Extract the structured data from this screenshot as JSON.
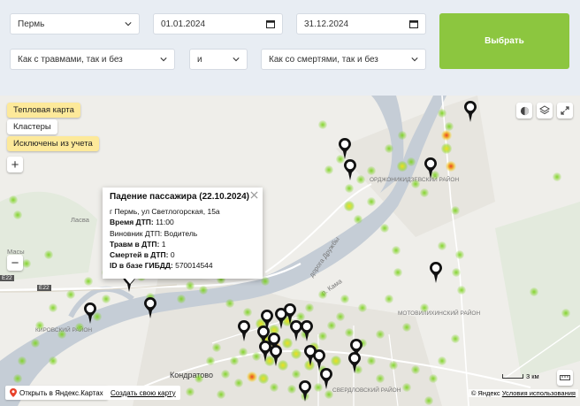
{
  "filters": {
    "city": "Пермь",
    "date_from": "01.01.2024",
    "date_to": "31.12.2024",
    "injuries": "Как с травмами, так и без",
    "logic": "и",
    "deaths": "Как со смертями, так и без",
    "submit_label": "Выбрать"
  },
  "map": {
    "layers": {
      "heatmap": "Тепловая карта",
      "clusters": "Клaстеры",
      "excluded": "Исключены из учета"
    },
    "zoom_in": "+",
    "zoom_out": "−",
    "popup": {
      "title": "Падение пассажира (22.10.2024)",
      "address": "г Пермь, ул Светлогорская, 15а",
      "time_label": "Время ДТП:",
      "time_value": "11:00",
      "culprit_label": "Виновник ДТП:",
      "culprit_value": "Водитель",
      "injured_label": "Травм в ДТП:",
      "injured_value": "1",
      "deaths_label": "Смертей в ДТП:",
      "deaths_value": "0",
      "id_label": "ID в базе ГИБДД:",
      "id_value": "570014544"
    },
    "labels": {
      "kondratovo": "Кондратово",
      "lasva": "Ласва",
      "masy": "Масы",
      "kirovsky": "КИРОВСКИЙ РАЙОН",
      "ordzhon": "ОРДЖОНИКИДЗЕВСКИЙ РАЙОН",
      "motovil": "МОТОВИЛИХИНСКИЙ РАЙОН",
      "sverdl": "СВЕРДЛОВСКИЙ РАЙОН",
      "kama": "р. Кама",
      "road": "дорога Дружбы",
      "e22": "E22"
    },
    "scale": "3 км",
    "open_in_yandex": "Открыть в Яндекс.Картах",
    "create_map": "Создать свою карту",
    "copyright": "© Яндекс",
    "terms": "Условия использования",
    "colors": {
      "heat_green": "#7ed321",
      "heat_yellow": "#f2e01a",
      "heat_red": "#e8412a",
      "river": "#c5cdd6",
      "accent": "#8cc63f"
    }
  }
}
